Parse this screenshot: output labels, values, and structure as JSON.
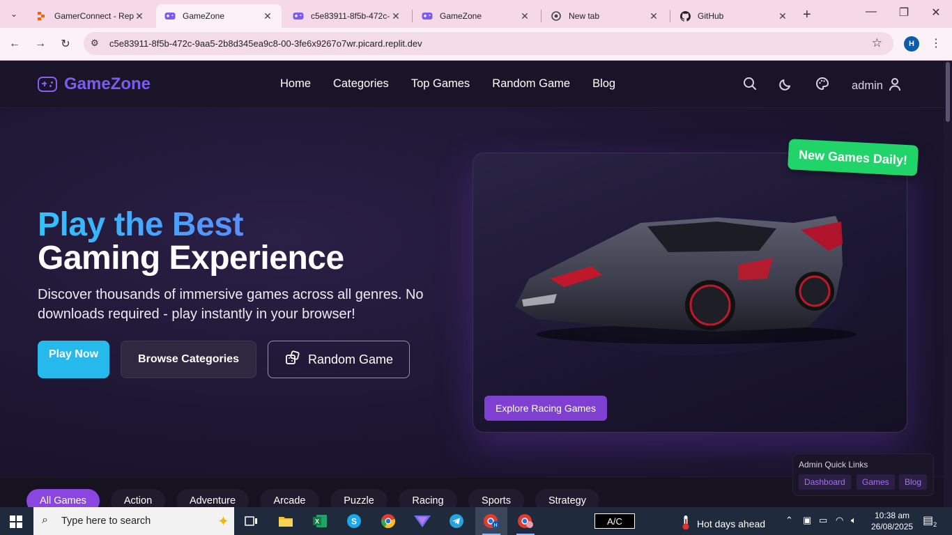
{
  "browser": {
    "tabs": [
      {
        "title": "GamerConnect - Repl",
        "favicon": "replit-icon"
      },
      {
        "title": "GameZone",
        "favicon": "gamepad-icon",
        "active": true
      },
      {
        "title": "c5e83911-8f5b-472c-",
        "favicon": "gamepad-icon"
      },
      {
        "title": "GameZone",
        "favicon": "gamepad-icon"
      },
      {
        "title": "New tab",
        "favicon": "chrome-icon"
      },
      {
        "title": "GitHub",
        "favicon": "github-icon"
      }
    ],
    "url": "c5e83911-8f5b-472c-9aa5-2b8d345ea9c8-00-3fe6x9267o7wr.picard.replit.dev",
    "profile_initial": "H"
  },
  "site": {
    "logo": "GameZone",
    "nav": [
      "Home",
      "Categories",
      "Top Games",
      "Random Game",
      "Blog"
    ],
    "user": "admin"
  },
  "hero": {
    "title_line1": "Play the Best",
    "title_line2": "Gaming Experience",
    "description": "Discover thousands of immersive games across all genres. No downloads required - play instantly in your browser!",
    "play_now": "Play Now",
    "browse_categories": "Browse Categories",
    "random_game": "Random Game",
    "explore": "Explore Racing Games",
    "badge": "New Games Daily!"
  },
  "categories": [
    "All Games",
    "Action",
    "Adventure",
    "Arcade",
    "Puzzle",
    "Racing",
    "Sports",
    "Strategy"
  ],
  "admin_links": {
    "heading": "Admin Quick Links",
    "links": [
      "Dashboard",
      "Games",
      "Blog"
    ]
  },
  "taskbar": {
    "search_placeholder": "Type here to search",
    "power_label": "A/C",
    "weather": "Hot days ahead",
    "time": "10:38 am",
    "date": "26/08/2025",
    "notifications": "2"
  },
  "colors": {
    "accent_purple": "#7c5cf0",
    "play_button": "#26b9ec",
    "badge_green": "#20d46a",
    "active_pill": "#8b45e0"
  }
}
